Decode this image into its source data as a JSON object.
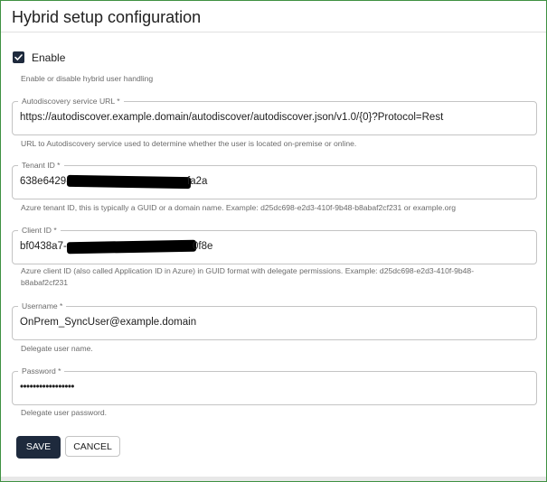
{
  "header": {
    "title": "Hybrid setup configuration"
  },
  "enable": {
    "label": "Enable",
    "checked": true,
    "helper": "Enable or disable hybrid user handling"
  },
  "autodiscovery": {
    "label": "Autodiscovery service URL *",
    "value": "https://autodiscover.example.domain/autodiscover/autodiscover.json/v1.0/{0}?Protocol=Rest",
    "helper": "URL to Autodiscovery service used to determine whether the user is located on-premise or online."
  },
  "tenant": {
    "label": "Tenant ID *",
    "value_start": "638e6429-",
    "value_end": "fa2a",
    "helper": "Azure tenant ID, this is typically a GUID or a domain name. Example: d25dc698-e2d3-410f-9b48-b8abaf2cf231 or example.org"
  },
  "client": {
    "label": "Client ID *",
    "value_start": "bf0438a7-",
    "value_end": "0f8e",
    "helper_line1": "Azure client ID (also called Application ID in Azure) in GUID format with delegate permissions. Example: d25dc698-e2d3-410f-9b48-",
    "helper_line2": "b8abaf2cf231"
  },
  "username": {
    "label": "Username *",
    "value": "OnPrem_SyncUser@example.domain",
    "helper": "Delegate user name."
  },
  "password": {
    "label": "Password *",
    "value": "•••••••••••••••••",
    "helper": "Delegate user password."
  },
  "actions": {
    "save_label": "SAVE",
    "cancel_label": "CANCEL"
  },
  "colors": {
    "primary": "#1e2a3d",
    "frame_border": "#3f9142",
    "helper_text": "#6b6b6b"
  }
}
